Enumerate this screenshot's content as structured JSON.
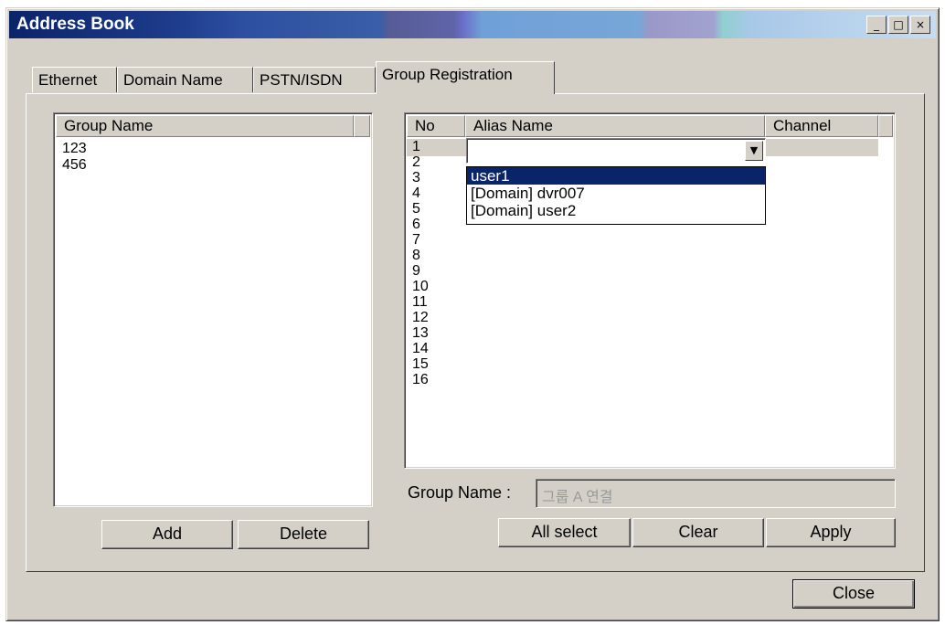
{
  "window": {
    "title": "Address Book",
    "controls": {
      "minimize": "_",
      "maximize": "□",
      "close": "×"
    }
  },
  "tabs": [
    {
      "label": "Ethernet",
      "active": false
    },
    {
      "label": "Domain Name",
      "active": false
    },
    {
      "label": "PSTN/ISDN",
      "active": false
    },
    {
      "label": "Group Registration",
      "active": true
    }
  ],
  "group_list": {
    "header": "Group Name",
    "items": [
      "123",
      "456"
    ]
  },
  "group_buttons": {
    "add": "Add",
    "delete": "Delete"
  },
  "member_table": {
    "headers": {
      "no": "No",
      "alias": "Alias Name",
      "channel": "Channel"
    },
    "rows": [
      "1",
      "2",
      "3",
      "4",
      "5",
      "6",
      "7",
      "8",
      "9",
      "10",
      "11",
      "12",
      "13",
      "14",
      "15",
      "16"
    ],
    "combo_value": "",
    "combo_arrow": "▼"
  },
  "alias_dropdown": {
    "options": [
      "user1",
      "[Domain] dvr007",
      "[Domain] user2"
    ],
    "selected_index": 0
  },
  "group_name_field": {
    "label": "Group Name :",
    "value": "그룹 A 연결"
  },
  "action_buttons": {
    "all_select": "All select",
    "clear": "Clear",
    "apply": "Apply"
  },
  "close_button": "Close"
}
